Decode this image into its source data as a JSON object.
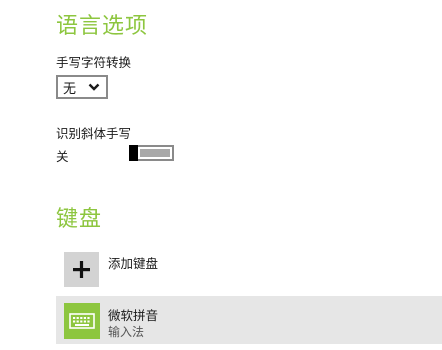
{
  "language_options": {
    "title": "语言选项",
    "handwriting": {
      "label": "手写字符转换",
      "selected": "无"
    },
    "italic": {
      "label": "识别斜体手写",
      "state_text": "关",
      "on": false
    }
  },
  "keyboards": {
    "title": "键盘",
    "add_label": "添加键盘",
    "items": [
      {
        "name": "微软拼音",
        "sub": "输入法"
      }
    ]
  },
  "colors": {
    "accent": "#8dc63f"
  },
  "icons": {
    "add": "plus-icon",
    "keyboard": "keyboard-icon",
    "dropdown": "chevron-down-icon"
  }
}
